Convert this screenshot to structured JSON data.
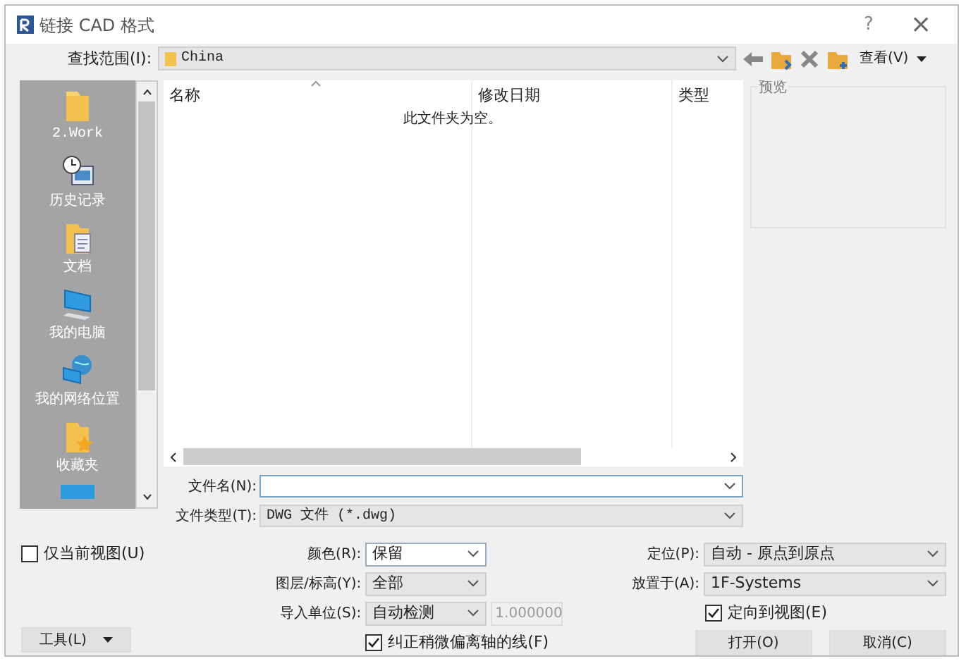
{
  "window": {
    "title": "链接 CAD 格式",
    "help": "?",
    "close": "×"
  },
  "look_in": {
    "label": "查找范围(I):",
    "value": "China",
    "view_label": "查看(V)"
  },
  "places": [
    {
      "label": "2.Work",
      "kind": "folder"
    },
    {
      "label": "历史记录",
      "kind": "history"
    },
    {
      "label": "文档",
      "kind": "documents"
    },
    {
      "label": "我的电脑",
      "kind": "computer"
    },
    {
      "label": "我的网络位置",
      "kind": "network"
    },
    {
      "label": "收藏夹",
      "kind": "favorites"
    }
  ],
  "file_list": {
    "columns": [
      "名称",
      "修改日期",
      "类型"
    ],
    "empty_message": "此文件夹为空。"
  },
  "preview": {
    "label": "预览"
  },
  "file_name": {
    "label": "文件名(N):"
  },
  "file_type": {
    "label": "文件类型(T):",
    "value": "DWG 文件 (*.dwg)"
  },
  "current_view_only": {
    "label": "仅当前视图(U)",
    "checked": false
  },
  "colors": {
    "label": "颜色(R):",
    "value": "保留"
  },
  "layers": {
    "label": "图层/标高(Y):",
    "value": "全部"
  },
  "import_units": {
    "label": "导入单位(S):",
    "value": "自动检测",
    "factor": "1.000000"
  },
  "correct_lines": {
    "label": "纠正稍微偏离轴的线(F)",
    "checked": true
  },
  "positioning": {
    "label": "定位(P):",
    "value": "自动 - 原点到原点"
  },
  "place_at": {
    "label": "放置于(A):",
    "value": "1F-Systems"
  },
  "orient_to_view": {
    "label": "定向到视图(E)",
    "checked": true
  },
  "tools": {
    "label": "工具(L)"
  },
  "buttons": [
    "打开(O)",
    "取消(C)"
  ]
}
